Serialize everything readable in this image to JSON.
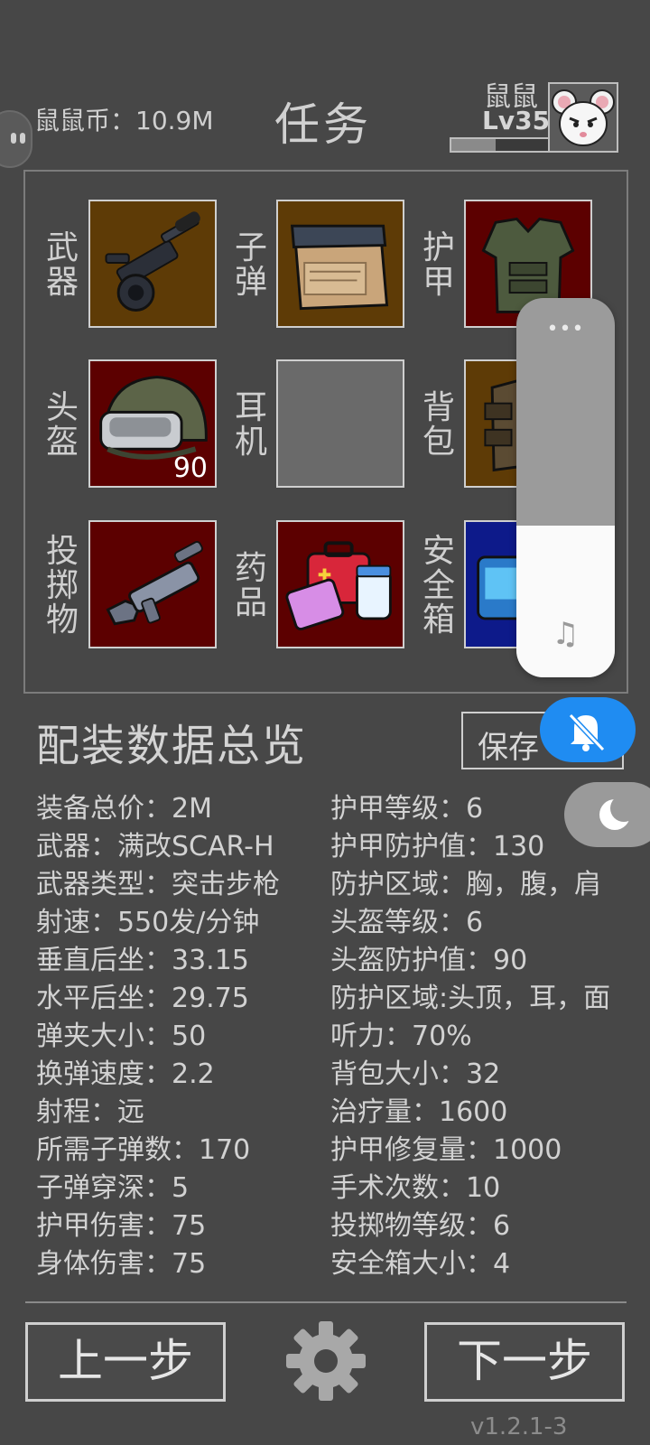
{
  "header": {
    "coins_label": "鼠鼠币：10.9M",
    "title": "任务",
    "username": "鼠鼠",
    "level": "Lv35",
    "xp_fraction": 0.45
  },
  "slots": [
    {
      "label": "武器",
      "icon": "rifle-icon"
    },
    {
      "label": "子弹",
      "icon": "ammo-box-icon"
    },
    {
      "label": "护甲",
      "icon": "body-armor-icon"
    },
    {
      "label": "头盔",
      "icon": "helmet-icon",
      "count": "90"
    },
    {
      "label": "耳机",
      "icon": "empty-slot"
    },
    {
      "label": "背包",
      "icon": "backpack-icon"
    },
    {
      "label": "投掷物",
      "icon": "grenade-launcher-icon"
    },
    {
      "label": "药品",
      "icon": "medkit-icon"
    },
    {
      "label": "安全箱",
      "icon": "secure-case-icon"
    }
  ],
  "summary": {
    "title": "配装数据总览",
    "save_label": "保存"
  },
  "stats_left": [
    "装备总价：2M",
    "武器：满改SCAR-H",
    "武器类型：突击步枪",
    "射速：550发/分钟",
    "垂直后坐：33.15",
    "水平后坐：29.75",
    "弹夹大小：50",
    "换弹速度：2.2",
    "射程：远",
    "所需子弹数：170",
    "子弹穿深：5",
    "护甲伤害：75",
    "身体伤害：75"
  ],
  "stats_right": [
    "护甲等级：6",
    "护甲防护值：130",
    "防护区域：胸，腹，肩",
    "头盔等级：6",
    "头盔防护值：90",
    "防护区域:头顶，耳，面",
    "听力：70%",
    "背包大小：32",
    "治疗量：1600",
    "护甲修复量：1000",
    "手术次数：10",
    "投掷物等级：6",
    "安全箱大小：4"
  ],
  "overlay": {
    "menu_dots": "•••",
    "music_glyph": "♫",
    "volume_level": 0.4,
    "accent": "#1f8cf2"
  },
  "footer": {
    "prev_label": "上一步",
    "next_label": "下一步",
    "version": "v1.2.1-3"
  },
  "colors": {
    "background": "#474747",
    "slot_brown": "#5e3b06",
    "slot_red": "#5c0000",
    "slot_gray": "#6a6a6a",
    "slot_blue": "#0d1a8a"
  }
}
